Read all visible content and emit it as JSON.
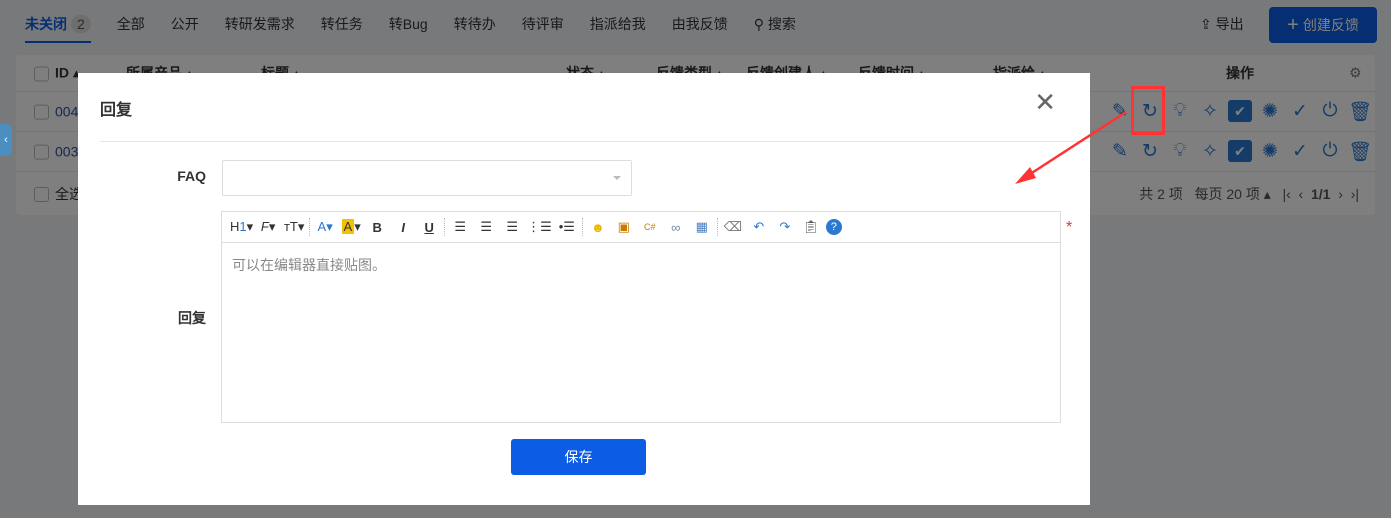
{
  "tabs": [
    {
      "label": "未关闭",
      "count": "2"
    },
    {
      "label": "全部"
    },
    {
      "label": "公开"
    },
    {
      "label": "转研发需求"
    },
    {
      "label": "转任务"
    },
    {
      "label": "转Bug"
    },
    {
      "label": "转待办"
    },
    {
      "label": "待评审"
    },
    {
      "label": "指派给我"
    },
    {
      "label": "由我反馈"
    },
    {
      "label": "搜索"
    }
  ],
  "toolbar": {
    "export": "导出",
    "create": "创建反馈"
  },
  "table": {
    "headers": [
      "ID",
      "所属产品",
      "标题",
      "状态",
      "反馈类型",
      "反馈创建人",
      "反馈时间",
      "指派给",
      "操作"
    ],
    "rows": [
      {
        "id": "004"
      },
      {
        "id": "003"
      }
    ],
    "select_all": "全选",
    "pager": {
      "total": "共 2 项",
      "per_page": "每页 20 项",
      "page": "1/1"
    }
  },
  "modal": {
    "title": "回复",
    "faq_label": "FAQ",
    "faq_value": "",
    "reply_label": "回复",
    "placeholder": "可以在编辑器直接贴图。",
    "required": "*",
    "save": "保存"
  },
  "colors": {
    "primary": "#0c5ce6",
    "highlight": "#ff3333"
  }
}
